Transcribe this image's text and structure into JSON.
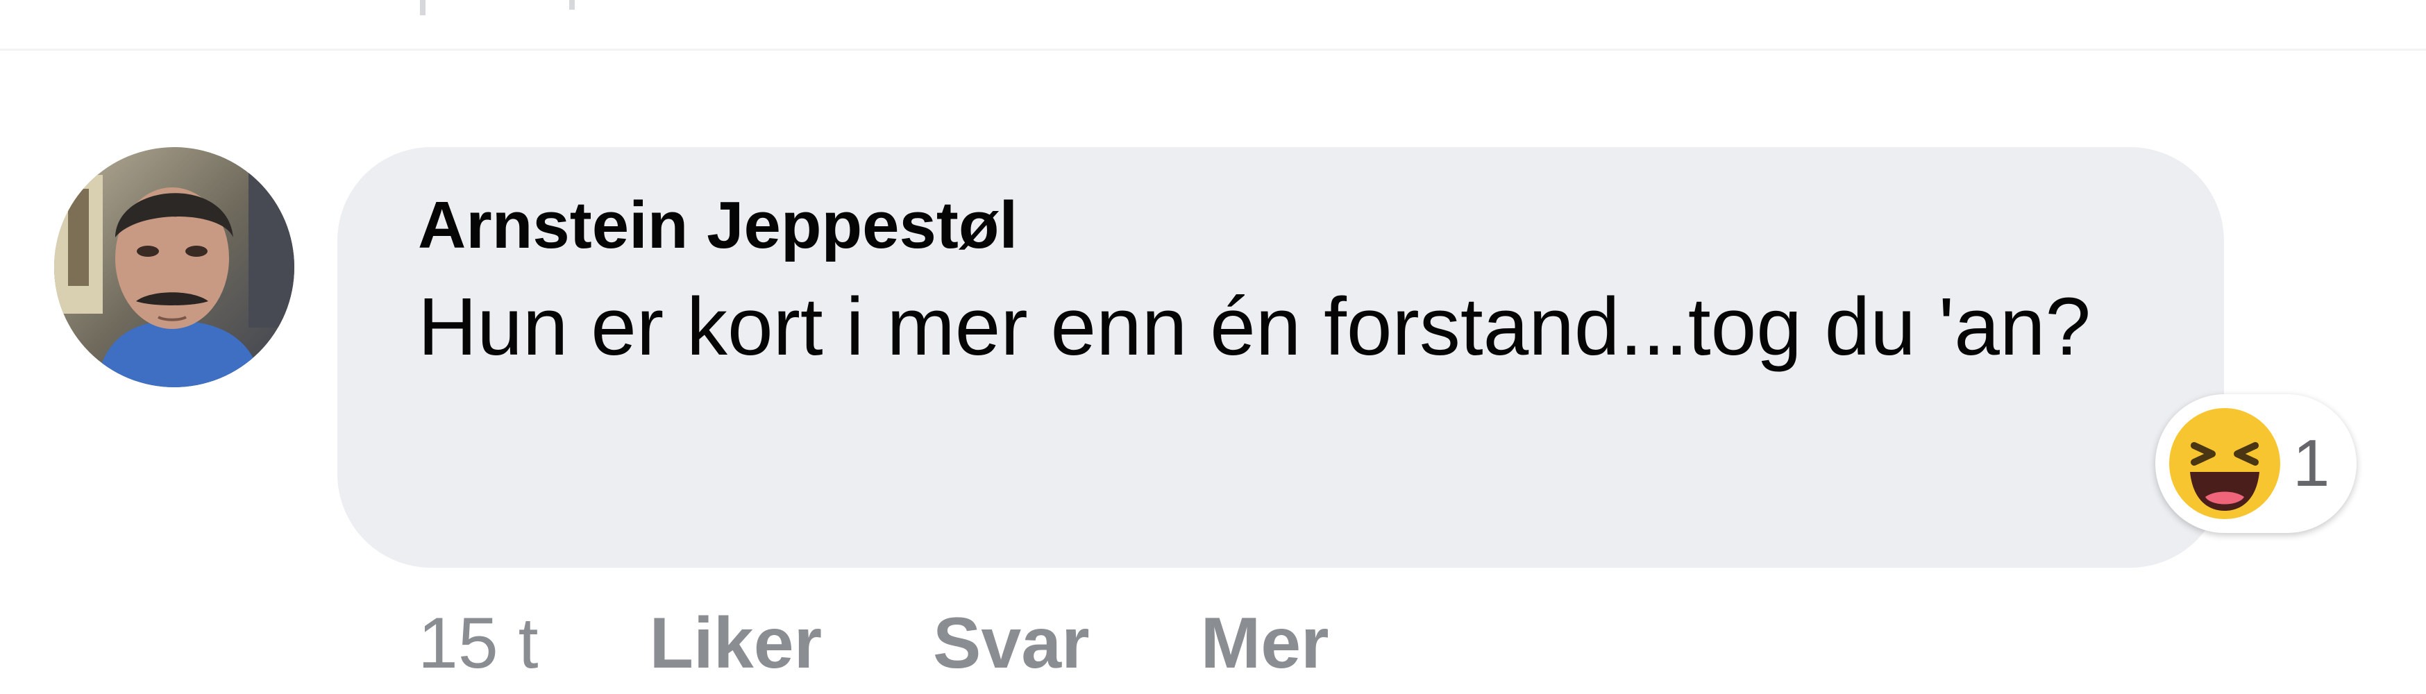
{
  "comment": {
    "author": "Arnstein Jeppestøl",
    "text": "Hun er kort i mer enn én forstand...tog du 'an?",
    "timestamp": "15 t",
    "reaction": {
      "icon": "haha-emoji",
      "count": "1"
    },
    "actions": {
      "like_label": "Liker",
      "reply_label": "Svar",
      "more_label": "Mer"
    }
  },
  "colors": {
    "bubble": "#eceef1",
    "text": "#050505",
    "muted": "#8a8d91",
    "emoji_yellow": "#f7c52f"
  }
}
